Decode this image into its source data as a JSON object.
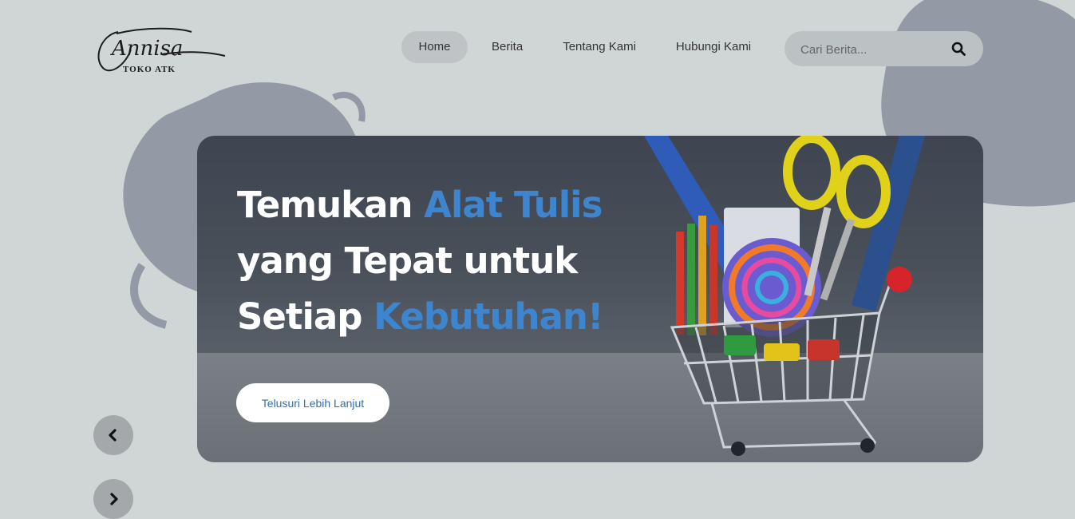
{
  "brand": {
    "logo_script": "Annisa",
    "logo_sub": "TOKO ATK"
  },
  "nav": {
    "items": [
      {
        "label": "Home",
        "active": true
      },
      {
        "label": "Berita",
        "active": false
      },
      {
        "label": "Tentang Kami",
        "active": false
      },
      {
        "label": "Hubungi Kami",
        "active": false
      }
    ]
  },
  "search": {
    "placeholder": "Cari Berita...",
    "value": "",
    "icon": "search-icon"
  },
  "hero": {
    "title_line1_a": "Temukan ",
    "title_line1_b": "Alat Tulis",
    "title_line2": "yang Tepat untuk",
    "title_line3_a": "Setiap ",
    "title_line3_b": "Kebutuhan!",
    "cta_label": "Telusuri Lebih Lanjut",
    "image": "shopping-cart-with-stationery"
  },
  "carousel": {
    "prev_icon": "chevron-left-icon",
    "next_icon": "chevron-right-icon"
  },
  "colors": {
    "background": "#d0d6d6",
    "accent": "#3d86cf",
    "nav_active": "#bfc3c5",
    "brush": "#9499a6"
  }
}
